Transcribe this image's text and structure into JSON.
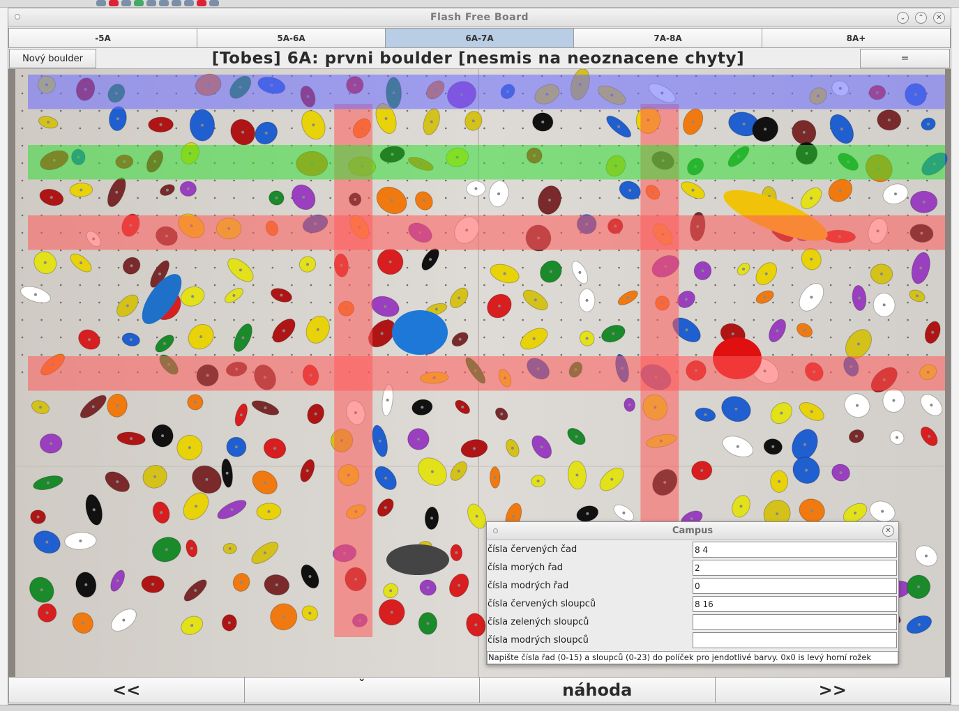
{
  "window": {
    "title": "Flash Free Board"
  },
  "tabs": [
    {
      "label": "-5A",
      "active": false
    },
    {
      "label": "5A-6A",
      "active": false
    },
    {
      "label": "6A-7A",
      "active": true
    },
    {
      "label": "7A-8A",
      "active": false
    },
    {
      "label": "8A+",
      "active": false
    }
  ],
  "header": {
    "new_button": "Nový boulder",
    "title": "[Tobes] 6A: prvni boulder [nesmis na neoznacene chyty]",
    "menu_button": "="
  },
  "board": {
    "highlight_colors": {
      "red": "#ff5a5a",
      "green": "#33dd33",
      "blue": "#6a6aff"
    },
    "red_rows": [
      8,
      4
    ],
    "green_rows": [
      2
    ],
    "blue_rows": [
      0
    ],
    "red_columns": [
      8,
      16
    ],
    "green_columns": [],
    "blue_columns": []
  },
  "nav": {
    "prev": "<<",
    "down": "ˇ",
    "random": "náhoda",
    "next": ">>"
  },
  "campus": {
    "title": "Campus",
    "fields": [
      {
        "label": "čísla červených čad",
        "value": "8 4"
      },
      {
        "label": "čísla morých řad",
        "value": "2"
      },
      {
        "label": "čísla modrých řad",
        "value": "0"
      },
      {
        "label": "čísla červených sloupců",
        "value": "8 16"
      },
      {
        "label": "čísla zelených sloupců",
        "value": ""
      },
      {
        "label": "čísla modrých sloupců",
        "value": ""
      }
    ],
    "hint": "Napište čísla řad (0-15) a sloupců (0-23) do políček pro jendotlivé barvy. 0x0 is levý horní rožek"
  }
}
